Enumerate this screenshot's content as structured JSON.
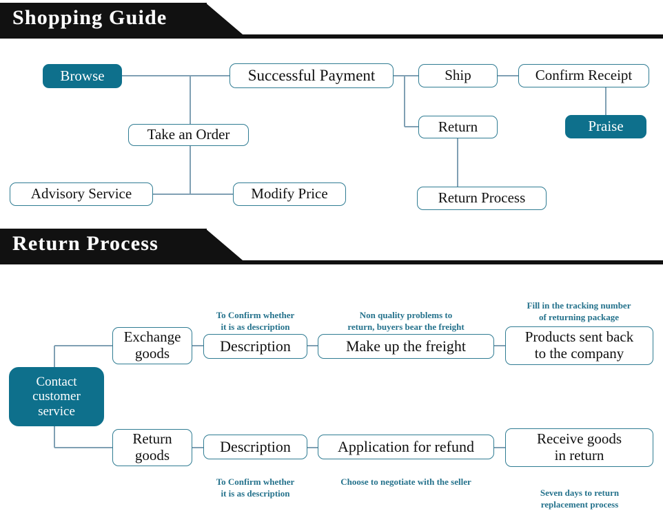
{
  "colors": {
    "accent_teal": "#0e708c",
    "node_border": "#2e7b92",
    "connector": "#7f9fb3",
    "banner_black": "#111111",
    "caption_text": "#25728c",
    "node_text": "#101010",
    "filled_node_text": "#ffffff",
    "page_background": "#ffffff"
  },
  "sections": [
    {
      "id": "shopping-guide",
      "header": {
        "title": "Shopping Guide"
      },
      "nodes": [
        {
          "id": "browse",
          "label": "Browse"
        },
        {
          "id": "successful-payment",
          "label": "Successful Payment"
        },
        {
          "id": "ship",
          "label": "Ship"
        },
        {
          "id": "confirm-receipt",
          "label": "Confirm Receipt"
        },
        {
          "id": "praise",
          "label": "Praise"
        },
        {
          "id": "take-an-order",
          "label": "Take an Order"
        },
        {
          "id": "return",
          "label": "Return"
        },
        {
          "id": "advisory-service",
          "label": "Advisory Service"
        },
        {
          "id": "modify-price",
          "label": "Modify Price"
        },
        {
          "id": "return-process",
          "label": "Return Process"
        }
      ]
    },
    {
      "id": "return-process",
      "header": {
        "title": "Return Process"
      },
      "nodes": [
        {
          "id": "contact-customer-service",
          "label": "Contact\ncustomer\nservice"
        },
        {
          "id": "exchange-goods",
          "label": "Exchange\ngoods"
        },
        {
          "id": "description-exchange",
          "label": "Description"
        },
        {
          "id": "make-up-the-freight",
          "label": "Make up the freight"
        },
        {
          "id": "products-sent-back",
          "label": "Products sent back\nto the company"
        },
        {
          "id": "return-goods",
          "label": "Return\ngoods"
        },
        {
          "id": "description-return",
          "label": "Description"
        },
        {
          "id": "application-for-refund",
          "label": "Application for refund"
        },
        {
          "id": "receive-goods-in-return",
          "label": "Receive goods\nin return"
        }
      ],
      "captions": [
        {
          "id": "caption-exchange-description",
          "text": "To Confirm whether\nit is as description"
        },
        {
          "id": "caption-make-up-freight",
          "text": "Non quality problems to\nreturn, buyers bear the freight"
        },
        {
          "id": "caption-products-sent-back",
          "text": "Fill in the tracking number\nof returning package"
        },
        {
          "id": "caption-return-description",
          "text": "To Confirm whether\nit is as description"
        },
        {
          "id": "caption-application-refund",
          "text": "Choose to negotiate with the seller"
        },
        {
          "id": "caption-receive-goods",
          "text": "Seven days to return\nreplacement process"
        }
      ]
    }
  ]
}
